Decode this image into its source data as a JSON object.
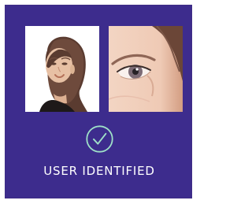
{
  "status": {
    "label": "USER IDENTIFIED"
  },
  "icons": {
    "success": "check-circle-icon"
  },
  "colors": {
    "panel_background": "#3d2c8d",
    "success_icon": "#9fe1c8",
    "text": "#ffffff"
  }
}
